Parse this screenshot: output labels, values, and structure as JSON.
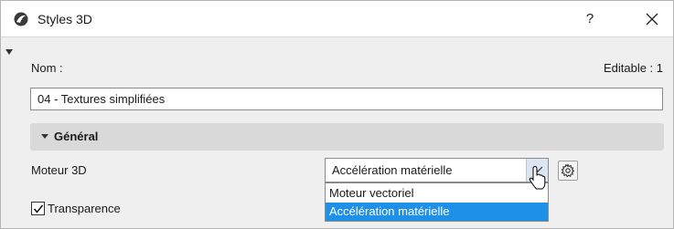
{
  "window": {
    "title": "Styles 3D",
    "help_label": "?"
  },
  "form": {
    "name_label": "Nom :",
    "editable_label": "Editable : 1",
    "name_value": "04 - Textures simplifiées"
  },
  "section": {
    "title": "Général"
  },
  "engine": {
    "label": "Moteur 3D",
    "selected": "Accélération matérielle",
    "options": [
      "Moteur vectoriel",
      "Accélération matérielle"
    ],
    "highlighted_index": 1
  },
  "transparency": {
    "label": "Transparence",
    "checked": true
  },
  "colors": {
    "highlight": "#1e90e8",
    "section_bg": "#d9d9d9",
    "window_bg": "#efefef"
  }
}
